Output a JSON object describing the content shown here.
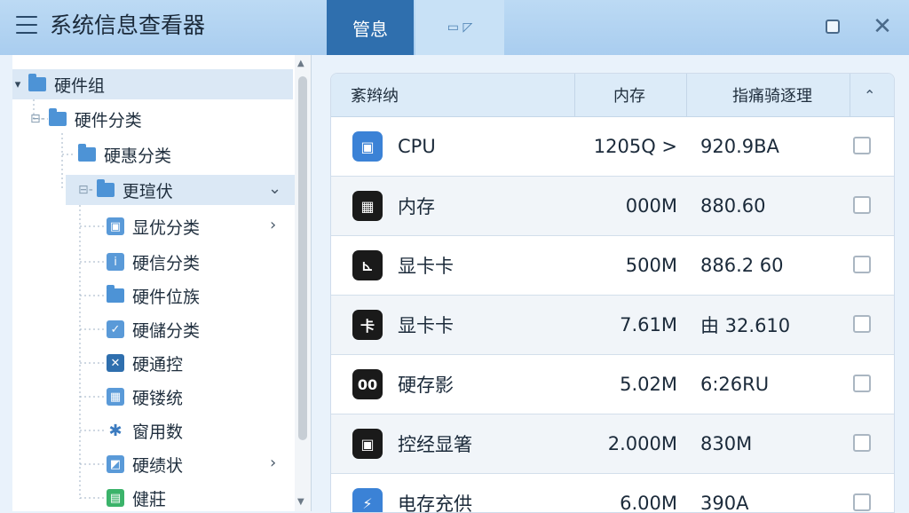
{
  "app": {
    "title": "系统信息查看器",
    "tabs": [
      {
        "label": "管息",
        "active": true
      },
      {
        "label": "▭ ◸",
        "active": false
      }
    ],
    "accent": "#2f6fae"
  },
  "tree": {
    "items": [
      {
        "label": "硬件组",
        "icon": "folder-icon"
      },
      {
        "label": "硬件分类",
        "icon": "folder-icon"
      },
      {
        "label": "硬惠分类",
        "icon": "folder-icon"
      },
      {
        "label": "更瑄伏",
        "icon": "folder-icon"
      },
      {
        "label": "显优分类",
        "icon": "display-icon"
      },
      {
        "label": "硬信分类",
        "icon": "info-icon"
      },
      {
        "label": "硬件位族",
        "icon": "folder-icon"
      },
      {
        "label": "硬儲分类",
        "icon": "storage-icon"
      },
      {
        "label": "硬通控",
        "icon": "cross-icon"
      },
      {
        "label": "硬镂统",
        "icon": "chart-icon"
      },
      {
        "label": "窗用数",
        "icon": "network-icon"
      },
      {
        "label": "硬绩状",
        "icon": "image-icon"
      },
      {
        "label": "健莊",
        "icon": "health-icon"
      }
    ]
  },
  "table": {
    "headers": {
      "name": "紊辫纳",
      "memory": "内存",
      "rate": "指痛骑逐理"
    },
    "rows": [
      {
        "name": "CPU",
        "memory": "1205Q >",
        "rate": "920.9BA",
        "icon": "cpu-icon",
        "icon_color": "#3b82d6"
      },
      {
        "name": "内存",
        "memory": "000M",
        "rate": "880.60",
        "icon": "memory-icon",
        "icon_color": "#1a1a1a"
      },
      {
        "name": "显卡卡",
        "memory": "500M",
        "rate": "886.2 60",
        "icon": "gpu-icon",
        "icon_color": "#1a1a1a"
      },
      {
        "name": "显卡卡",
        "memory": "7.61M",
        "rate": "由 32.610",
        "icon": "card-icon",
        "icon_color": "#1a1a1a"
      },
      {
        "name": "硬存影",
        "memory": "5.02M",
        "rate": "6:26RU",
        "icon": "disk-icon",
        "icon_color": "#1a1a1a"
      },
      {
        "name": "控经显箸",
        "memory": "2.000M",
        "rate": "830M",
        "icon": "chip-icon",
        "icon_color": "#1a1a1a"
      },
      {
        "name": "电存充供",
        "memory": "6.00M",
        "rate": "390A",
        "icon": "battery-icon",
        "icon_color": "#3b82d6"
      }
    ]
  }
}
